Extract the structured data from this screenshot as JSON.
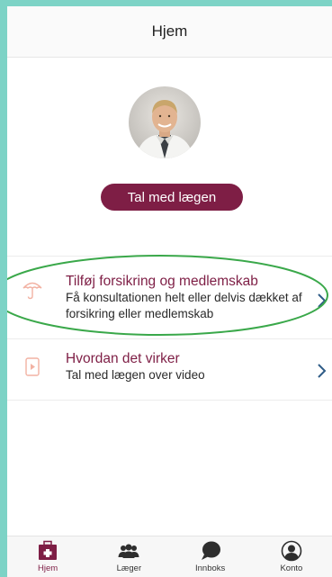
{
  "header": {
    "title": "Hjem"
  },
  "cta": {
    "label": "Tal med lægen"
  },
  "rows": [
    {
      "title": "Tilføj forsikring og medlemskab",
      "subtitle": "Få konsultationen helt eller delvis dækket af forsikring eller medlemskab",
      "icon": "umbrella-icon"
    },
    {
      "title": "Hvordan det virker",
      "subtitle": "Tal med lægen over video",
      "icon": "video-icon"
    }
  ],
  "tabs": [
    {
      "label": "Hjem",
      "icon": "medical-bag-icon",
      "active": true
    },
    {
      "label": "Læger",
      "icon": "people-icon",
      "active": false
    },
    {
      "label": "Innboks",
      "icon": "chat-icon",
      "active": false
    },
    {
      "label": "Konto",
      "icon": "account-icon",
      "active": false
    }
  ],
  "colors": {
    "brand": "#7e1e45",
    "accent_icon": "#f2b2a3",
    "chevron": "#2f5c87",
    "annotation": "#3aa84a"
  }
}
